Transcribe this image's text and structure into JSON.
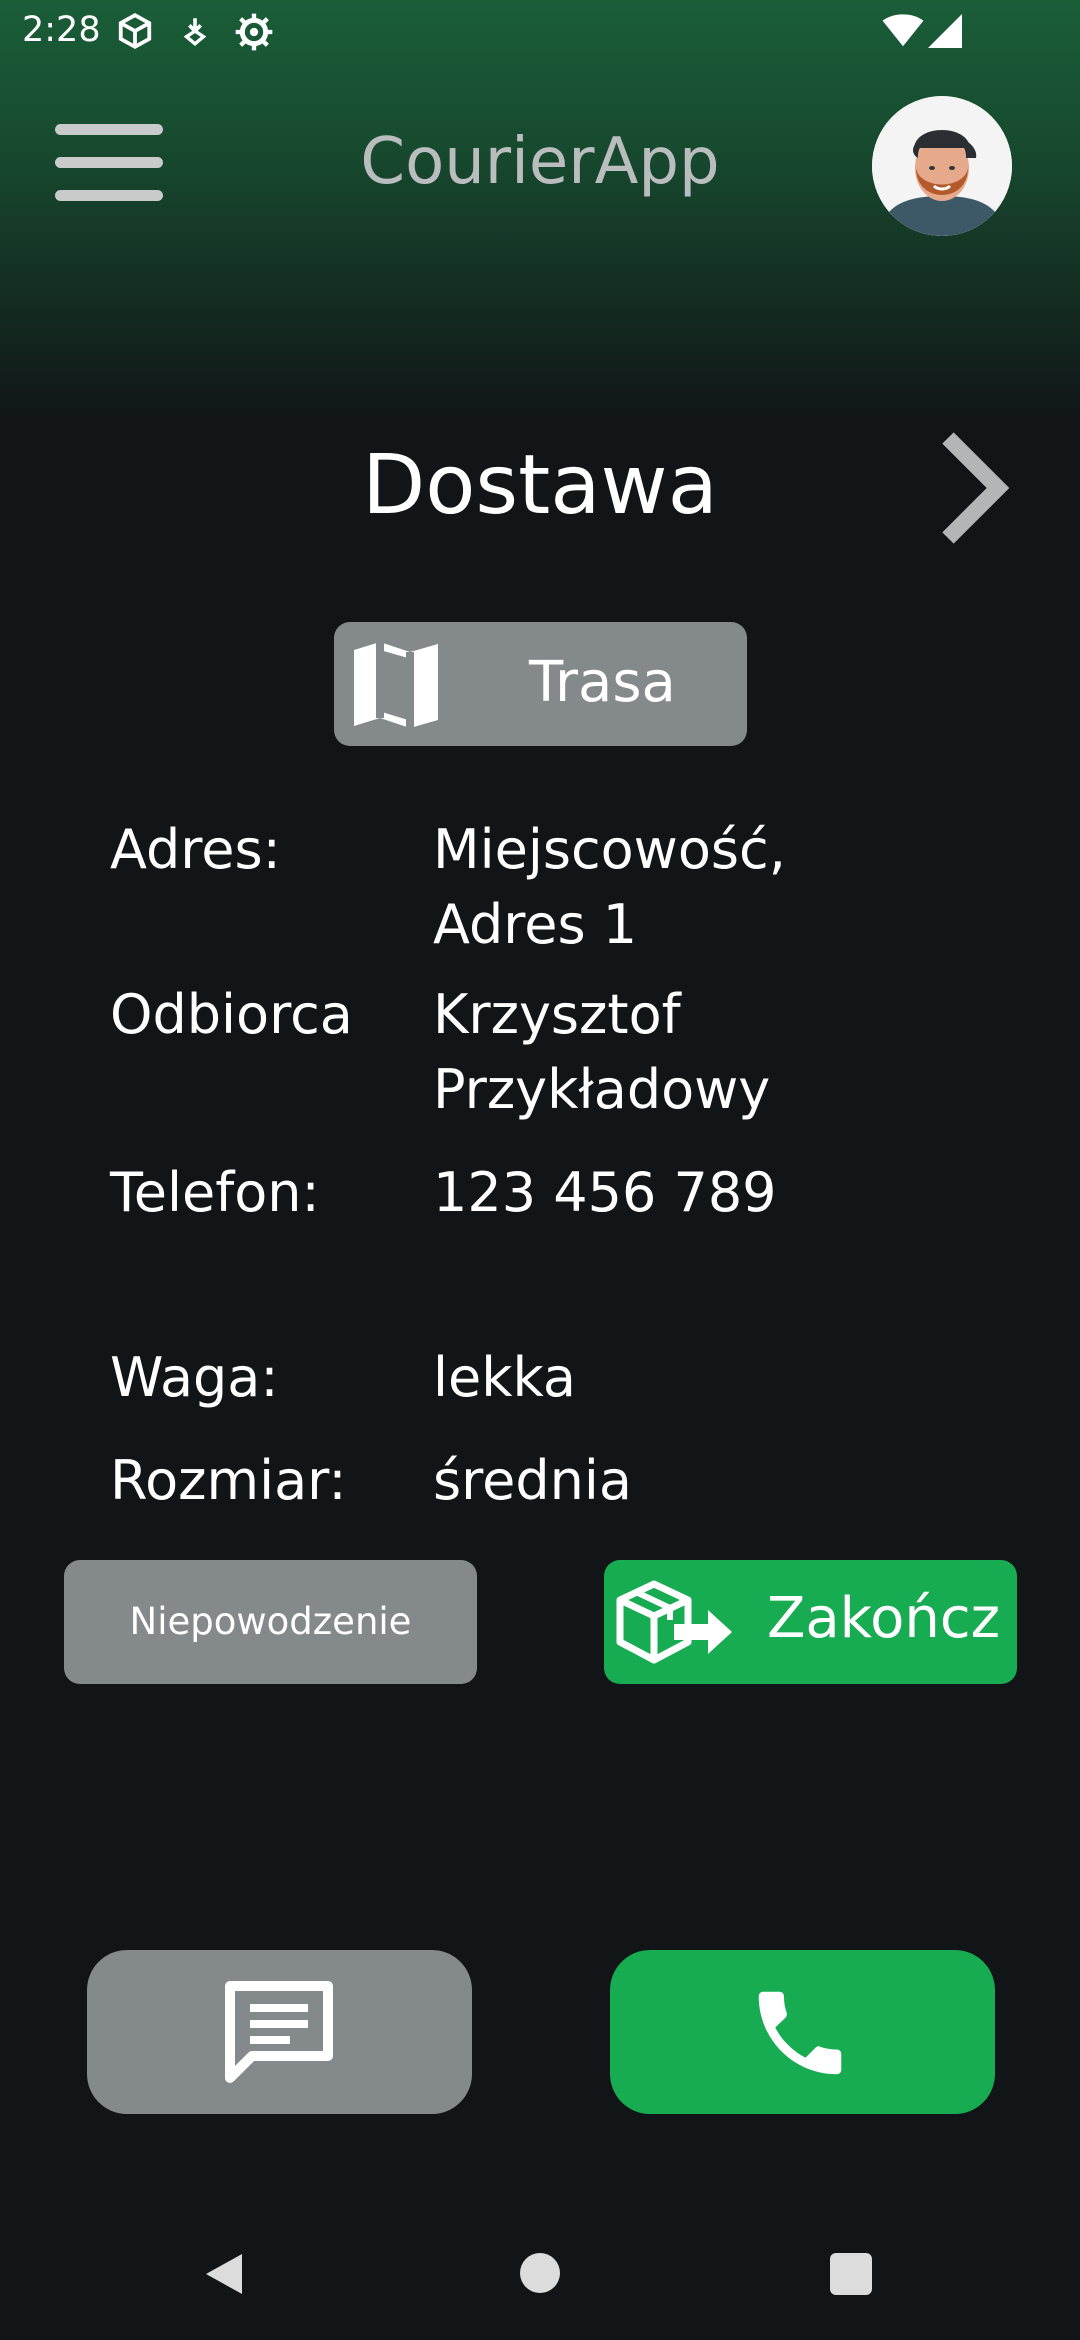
{
  "status_bar": {
    "time": "2:28",
    "icons": [
      "package-notification-icon",
      "download-notification-icon",
      "settings-notification-icon",
      "wifi-icon",
      "cell-signal-icon"
    ]
  },
  "app_bar": {
    "title": "CourierApp",
    "menu_icon": "hamburger-menu-icon",
    "avatar_icon": "user-avatar"
  },
  "page": {
    "title": "Dostawa",
    "next_icon": "chevron-right-icon"
  },
  "route_button": {
    "label": "Trasa",
    "icon": "map-icon"
  },
  "details": {
    "address_label": "Adres:",
    "address_line1": "Miejscowość,",
    "address_line2": "Adres 1",
    "recipient_label": "Odbiorca",
    "recipient_line1": "Krzysztof",
    "recipient_line2": "Przykładowy",
    "phone_label": "Telefon:",
    "phone_value": "123 456 789",
    "weight_label": "Waga:",
    "weight_value": "lekka",
    "size_label": "Rozmiar:",
    "size_value": "średnia"
  },
  "actions": {
    "fail_label": "Niepowodzenie",
    "finish_label": "Zakończ",
    "finish_icon": "package-deliver-icon"
  },
  "contact": {
    "message_icon": "message-icon",
    "call_icon": "phone-icon"
  },
  "colors": {
    "header_green": "#1a5e38",
    "background": "#111517",
    "gray_button": "#848a8b",
    "accent_green": "#17ab52"
  }
}
